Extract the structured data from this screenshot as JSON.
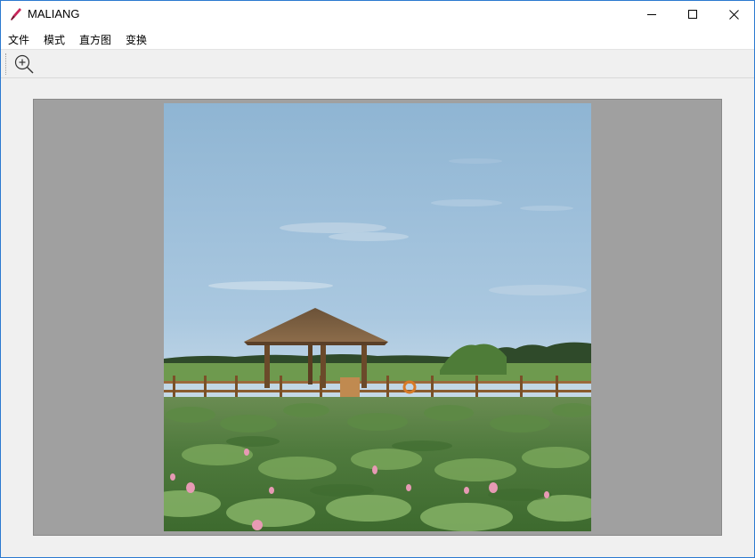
{
  "window": {
    "title": "MALIANG",
    "controls": [
      "minimize-icon",
      "maximize-icon",
      "close-icon"
    ],
    "accent_color": "#2b79d0"
  },
  "menu": {
    "items": [
      "文件",
      "模式",
      "直方图",
      "变换"
    ]
  },
  "toolbar": {
    "tools": [
      "zoom-in-icon"
    ]
  },
  "canvas": {
    "background_color": "#a0a0a0",
    "image_subject": "lotus pond with wooden pavilion"
  }
}
